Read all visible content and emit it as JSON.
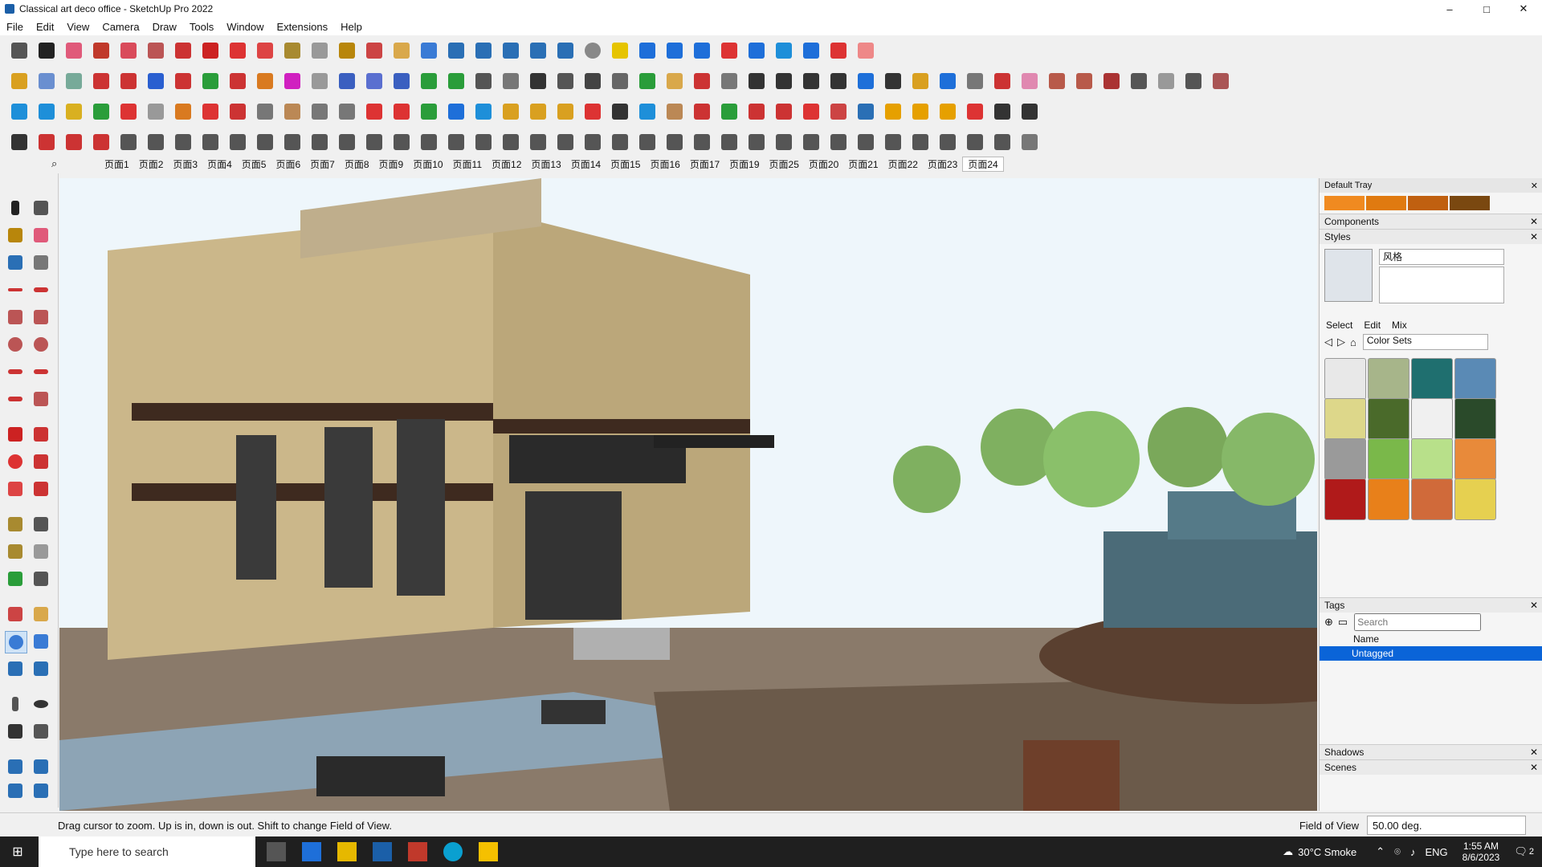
{
  "window": {
    "title": "Classical art deco office - SketchUp Pro 2022",
    "min": "–",
    "max": "□",
    "close": "✕"
  },
  "menu": [
    "File",
    "Edit",
    "View",
    "Camera",
    "Draw",
    "Tools",
    "Window",
    "Extensions",
    "Help"
  ],
  "scenes": [
    "页面1",
    "页面2",
    "页面3",
    "页面4",
    "页面5",
    "页面6",
    "页面7",
    "页面8",
    "页面9",
    "页面10",
    "页面11",
    "页面12",
    "页面13",
    "页面14",
    "页面15",
    "页面16",
    "页面17",
    "页面19",
    "页面25",
    "页面20",
    "页面21",
    "页面22",
    "页面23",
    "页面24"
  ],
  "tray": {
    "title": "Default Tray",
    "components_label": "Components",
    "styles_label": "Styles",
    "style_name": "风格",
    "tabs": [
      "Select",
      "Edit",
      "Mix"
    ],
    "collection": "Color Sets",
    "tags_label": "Tags",
    "tags_search_placeholder": "Search",
    "tags_col_name": "Name",
    "tag_row": "Untagged",
    "shadows_label": "Shadows",
    "scenes_label": "Scenes"
  },
  "status": {
    "message": "Drag cursor to zoom.  Up is in, down is out. Shift to change Field of View.",
    "fov_label": "Field of View",
    "fov_value": "50.00 deg."
  },
  "taskbar": {
    "search_placeholder": "Type here to search",
    "weather": "30°C  Smoke",
    "lang": "ENG",
    "time": "1:55 AM",
    "date": "8/6/2023",
    "notif": "2"
  },
  "colors": {
    "accent": "#0078d7",
    "selection": "#0a64d8"
  }
}
